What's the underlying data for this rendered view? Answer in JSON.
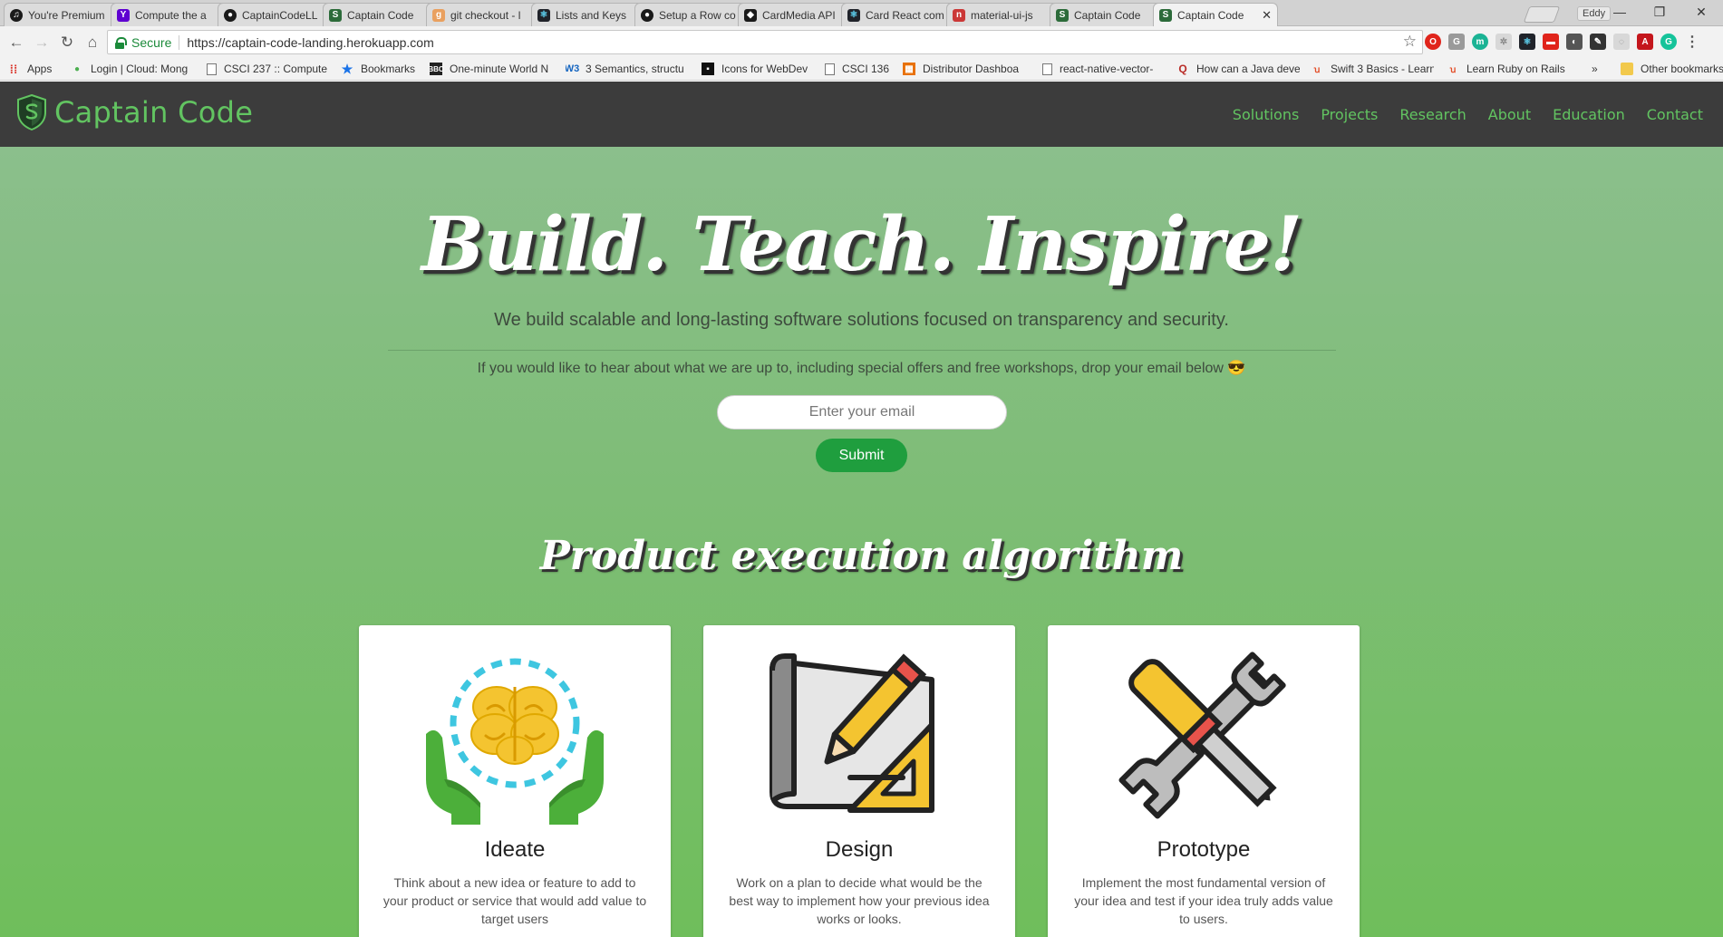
{
  "browser": {
    "tabs": [
      {
        "label": "You're Premium",
        "icon": "spotify-icon",
        "color": "#1a1a1a"
      },
      {
        "label": "Compute the a",
        "icon": "yahoo-icon",
        "color": "#5f01d1"
      },
      {
        "label": "CaptainCodeLL",
        "icon": "github-icon",
        "color": "#1a1a1a"
      },
      {
        "label": "Captain Code",
        "icon": "shield-icon",
        "color": "#2c6b3a"
      },
      {
        "label": "git checkout - l",
        "icon": "git-icon",
        "color": "#e9a05f"
      },
      {
        "label": "Lists and Keys",
        "icon": "react-icon",
        "color": "#20232a"
      },
      {
        "label": "Setup a Row co",
        "icon": "github-icon",
        "color": "#1a1a1a"
      },
      {
        "label": "CardMedia API",
        "icon": "material-ui-icon",
        "color": "#1a1a1a"
      },
      {
        "label": "Card React com",
        "icon": "react-icon",
        "color": "#20232a"
      },
      {
        "label": "material-ui-js",
        "icon": "npm-icon",
        "color": "#cb3837"
      },
      {
        "label": "Captain Code",
        "icon": "shield-icon",
        "color": "#2c6b3a"
      },
      {
        "label": "Captain Code",
        "icon": "shield-icon",
        "color": "#2c6b3a"
      }
    ],
    "profile": "Eddy",
    "secure_label": "Secure",
    "url": "https://captain-code-landing.herokuapp.com",
    "bookmarks": [
      {
        "label": "Apps"
      },
      {
        "label": "Login | Cloud: Mong"
      },
      {
        "label": "CSCI 237 :: Compute"
      },
      {
        "label": "Bookmarks"
      },
      {
        "label": "One-minute World N"
      },
      {
        "label": "3 Semantics, structu"
      },
      {
        "label": "Icons for WebDev"
      },
      {
        "label": "CSCI 136"
      },
      {
        "label": "Distributor Dashboa"
      },
      {
        "label": "react-native-vector-"
      },
      {
        "label": "How can a Java deve"
      },
      {
        "label": "Swift 3 Basics - Learn"
      },
      {
        "label": "Learn Ruby on Rails"
      },
      {
        "label": "»"
      },
      {
        "label": "Other bookmarks"
      }
    ]
  },
  "site": {
    "brand": "Captain Code",
    "nav": [
      "Solutions",
      "Projects",
      "Research",
      "About",
      "Education",
      "Contact"
    ],
    "accent": "#62c461",
    "header_bg": "#3c3c3c"
  },
  "hero": {
    "title": "Build. Teach. Inspire!",
    "subtitle": "We build scalable and long-lasting software solutions focused on transparency and security.",
    "note": "If you would like to hear about what we are up to, including special offers and free workshops, drop your email below 😎",
    "email_placeholder": "Enter your email",
    "submit_label": "Submit",
    "button_color": "#1f9e3e"
  },
  "process": {
    "title": "Product execution algorithm",
    "cards": [
      {
        "icon": "brain-in-hands-icon",
        "title": "Ideate",
        "text": "Think about a new idea or feature to add to your product or service that would add value to target users"
      },
      {
        "icon": "blueprint-pencil-icon",
        "title": "Design",
        "text": "Work on a plan to decide what would be the best way to implement how your previous idea works or looks."
      },
      {
        "icon": "screwdriver-wrench-icon",
        "title": "Prototype",
        "text": "Implement the most fundamental version of your idea and test if your idea truly adds value to users."
      }
    ]
  }
}
